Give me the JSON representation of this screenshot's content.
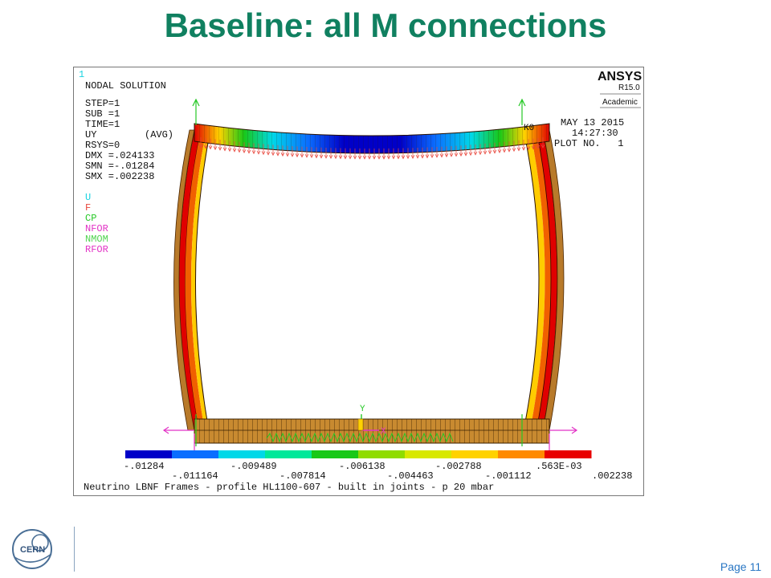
{
  "slide": {
    "title": "Baseline: all M connections",
    "page_label": "Page 11",
    "logo_text": "CERN"
  },
  "ansys": {
    "window_number": "1",
    "header": "NODAL SOLUTION",
    "params": [
      "STEP=1",
      "SUB =1",
      "TIME=1",
      "UY",
      "RSYS=0",
      "DMX =.024133",
      "SMN =-.01284",
      "SMX =.002238"
    ],
    "avg_label": "(AVG)",
    "legend": [
      {
        "label": "U",
        "color": "#19d3e0"
      },
      {
        "label": "F",
        "color": "#e8463c"
      },
      {
        "label": "CP",
        "color": "#25c825"
      },
      {
        "label": "NFOR",
        "color": "#e233c6"
      },
      {
        "label": "NMOM",
        "color": "#52d552"
      },
      {
        "label": "RFOR",
        "color": "#e233c6"
      }
    ],
    "logo": {
      "name": "ANSYS",
      "version": "R15.0",
      "edition": "Academic"
    },
    "date": "MAY 13 2015",
    "time": "14:27:30",
    "plot_no": "PLOT NO.   1",
    "node_label": "K0",
    "axis_y": "Y",
    "axis_x": "X",
    "footer": "Neutrino LBNF Frames - profile HL1100-607 - built in joints - p 20 mbar",
    "colorbar": {
      "colors": [
        "#0000c8",
        "#0a6eff",
        "#00d8e8",
        "#00e89a",
        "#18c818",
        "#90dc00",
        "#d8e800",
        "#ffd200",
        "#ff8a00",
        "#e80000"
      ],
      "labels_top": [
        "-.01284",
        "-.009489",
        "-.006138",
        "-.002788",
        ".563E-03"
      ],
      "labels_bottom": [
        "-.011164",
        "-.007814",
        "-.004463",
        "-.001112",
        ".002238"
      ]
    }
  }
}
